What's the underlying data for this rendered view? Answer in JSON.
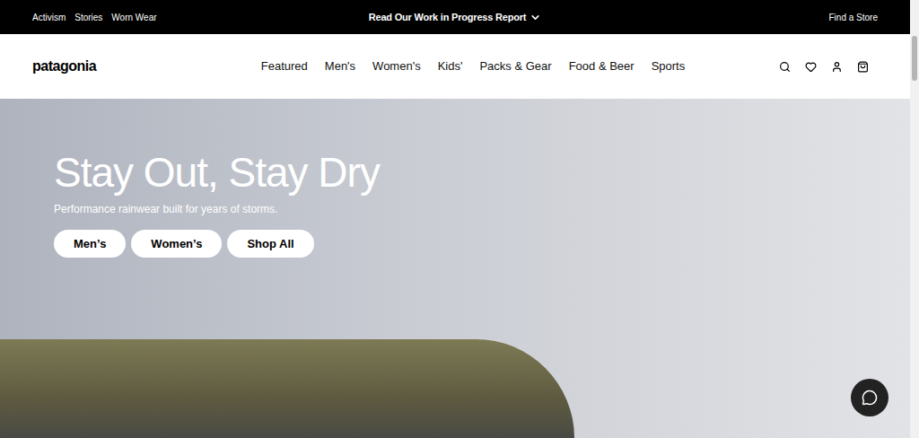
{
  "top_bar": {
    "links": [
      "Activism",
      "Stories",
      "Worn Wear"
    ],
    "announcement": "Read Our Work in Progress Report",
    "store_link": "Find a Store"
  },
  "header": {
    "logo": "patagonia",
    "nav": [
      {
        "label": "Featured",
        "selected": false
      },
      {
        "label": "Men's",
        "selected": false
      },
      {
        "label": "Women's",
        "selected": false
      },
      {
        "label": "Kids'",
        "selected": false
      },
      {
        "label": "Packs & Gear",
        "selected": false
      },
      {
        "label": "Food & Beer",
        "selected": false
      },
      {
        "label": "Sports",
        "selected": false
      }
    ]
  },
  "hero": {
    "title": "Stay Out, Stay Dry",
    "subtitle": "Performance rainwear built for years of storms.",
    "buttons": [
      "Men’s",
      "Women’s",
      "Shop All"
    ]
  }
}
